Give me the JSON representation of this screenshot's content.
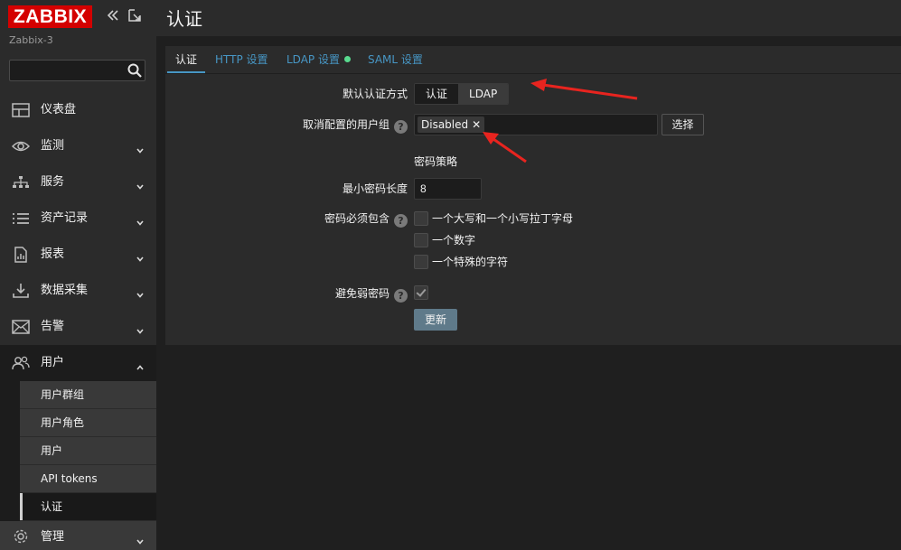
{
  "brand": {
    "logo_text": "ZABBIX",
    "server_name": "Zabbix-3",
    "brand_color": "#d40000"
  },
  "sidebar": {
    "collapse_icon": "double-chevron-left-icon",
    "kiosk_icon": "expand-icon",
    "search": {
      "value": "",
      "placeholder": ""
    },
    "menu": [
      {
        "label": "仪表盘",
        "icon": "dashboard-icon",
        "has_caret": false
      },
      {
        "label": "监测",
        "icon": "eye-icon",
        "has_caret": true
      },
      {
        "label": "服务",
        "icon": "services-icon",
        "has_caret": true
      },
      {
        "label": "资产记录",
        "icon": "list-icon",
        "has_caret": true
      },
      {
        "label": "报表",
        "icon": "report-icon",
        "has_caret": true
      },
      {
        "label": "数据采集",
        "icon": "download-icon",
        "has_caret": true
      },
      {
        "label": "告警",
        "icon": "mail-icon",
        "has_caret": true
      },
      {
        "label": "用户",
        "icon": "users-icon",
        "has_caret": true,
        "expanded": true
      }
    ],
    "users_submenu": [
      "用户群组",
      "用户角色",
      "用户",
      "API tokens",
      "认证"
    ],
    "selected_submenu": "认证",
    "admin_item": {
      "label": "管理",
      "icon": "gear-icon"
    }
  },
  "page": {
    "title": "认证"
  },
  "tabs": [
    {
      "label": "认证",
      "active": true
    },
    {
      "label": "HTTP 设置",
      "active": false
    },
    {
      "label": "LDAP 设置",
      "active": false,
      "status_dot": true
    },
    {
      "label": "SAML 设置",
      "active": false
    }
  ],
  "form": {
    "default_auth_label": "默认认证方式",
    "default_auth_options": [
      "认证",
      "LDAP"
    ],
    "default_auth_selected": "LDAP",
    "deprovision_label": "取消配置的用户组",
    "deprovision_chip": "Disabled",
    "select_button": "选择",
    "password_policy_title": "密码策略",
    "min_length_label": "最小密码长度",
    "min_length_value": "8",
    "must_contain_label": "密码必须包含",
    "must_contain_options": [
      {
        "label": "一个大写和一个小写拉丁字母",
        "checked": false
      },
      {
        "label": "一个数字",
        "checked": false
      },
      {
        "label": "一个特殊的字符",
        "checked": false
      }
    ],
    "avoid_weak_label": "避免弱密码",
    "avoid_weak_checked": true,
    "update_button": "更新",
    "help_glyph": "?"
  },
  "colors": {
    "link": "#4796c4",
    "status_ok": "#59db8f",
    "annotation_arrow": "#e8241f"
  }
}
